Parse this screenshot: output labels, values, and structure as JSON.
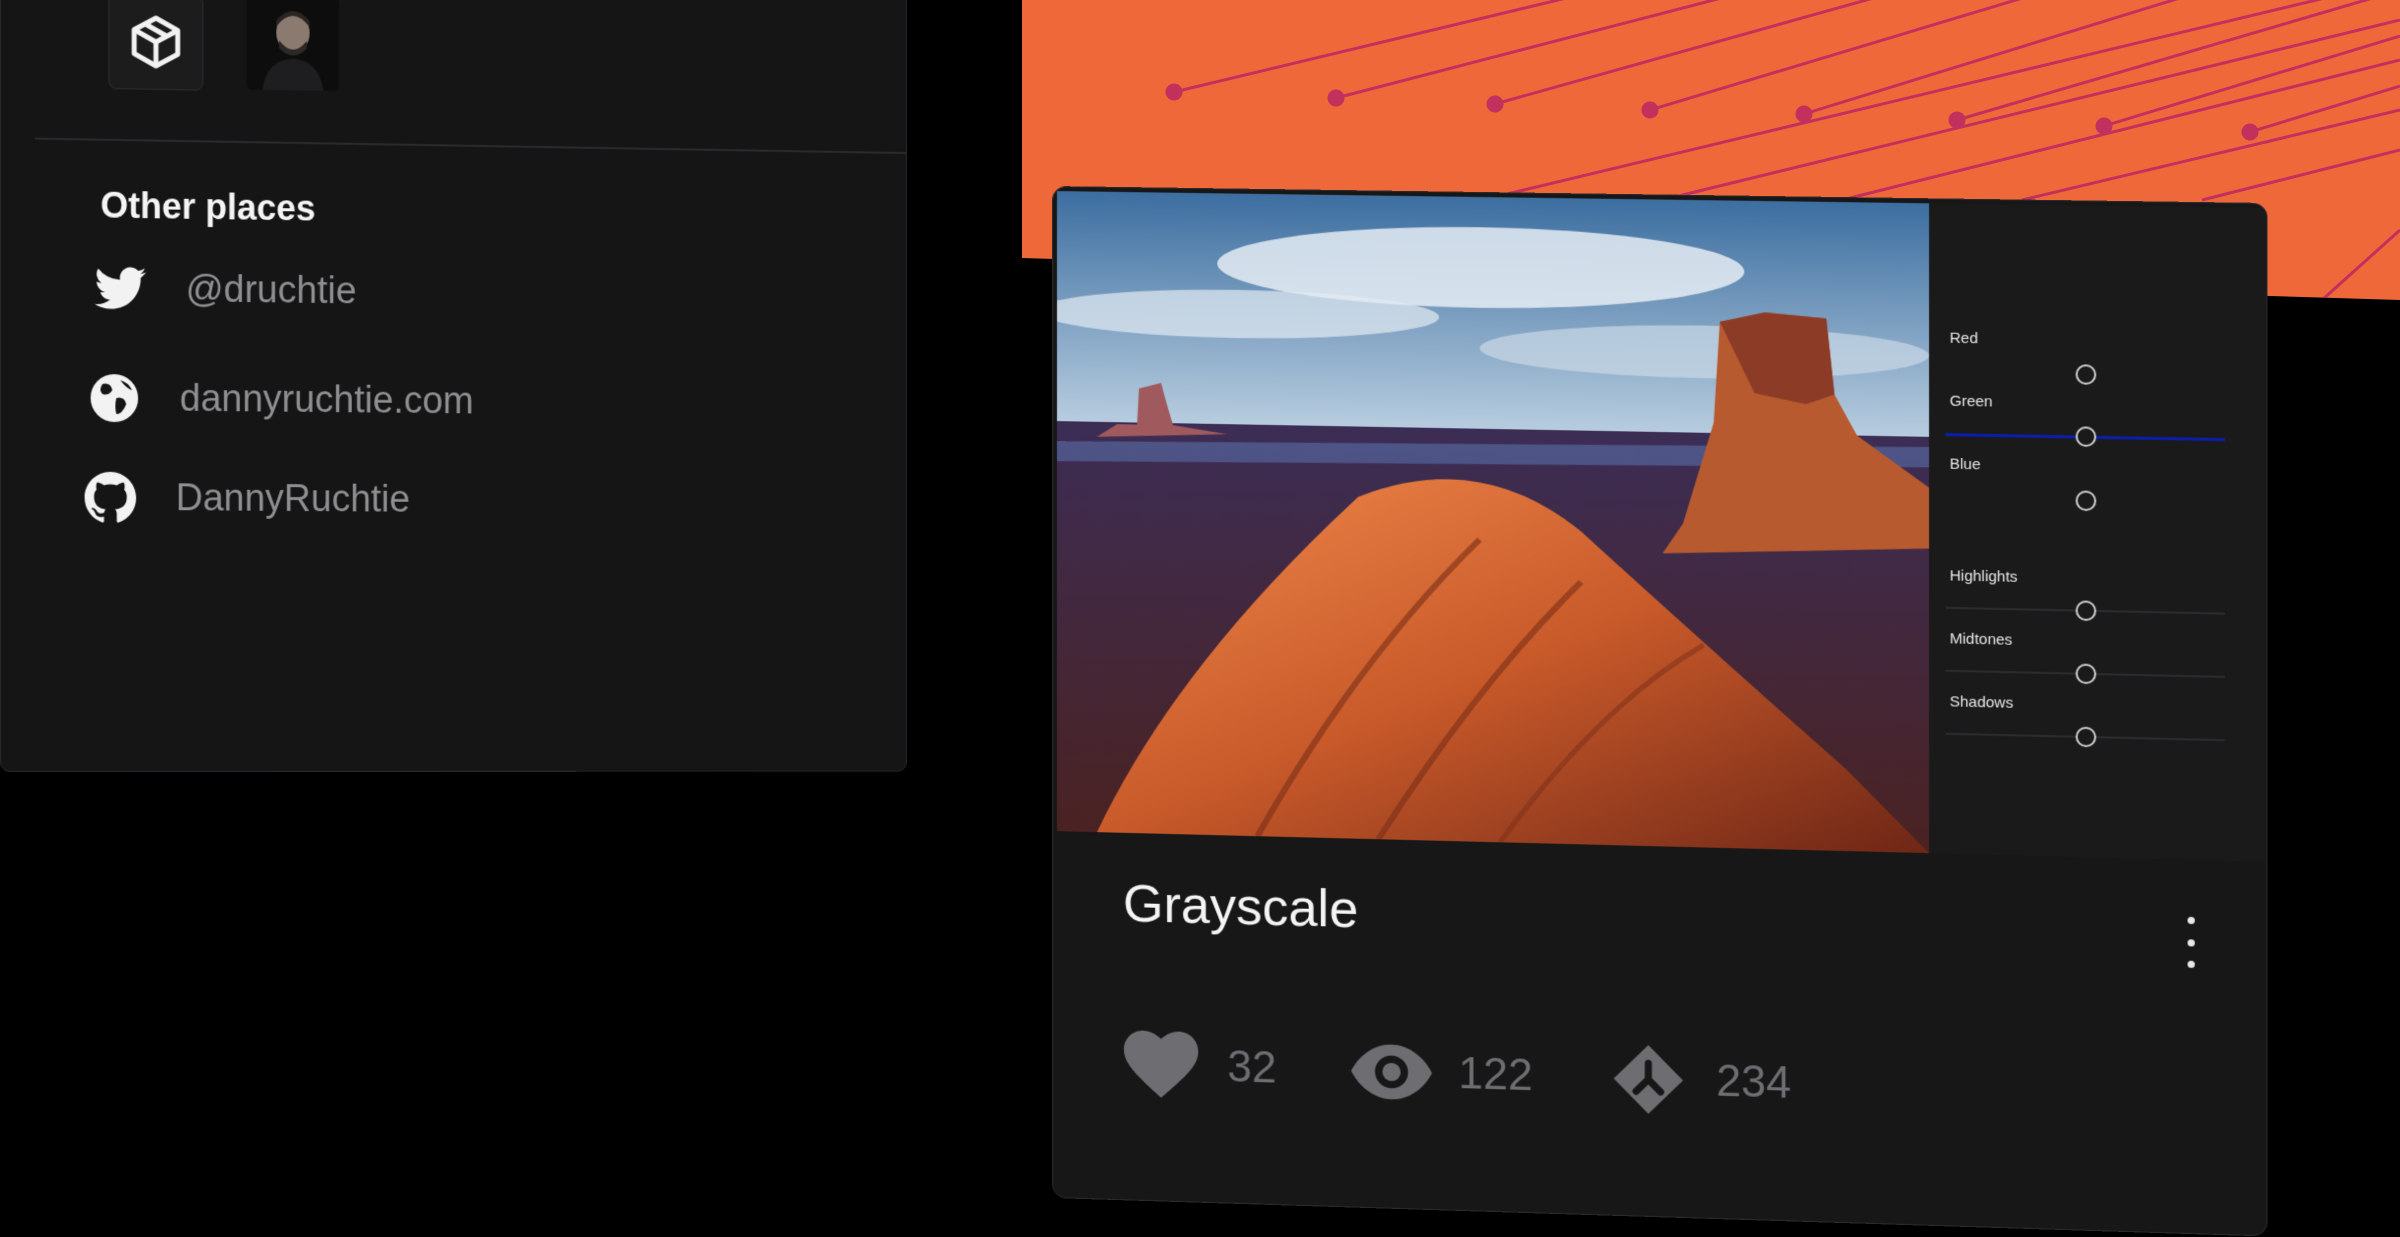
{
  "profile": {
    "top_icons": [
      "codepen-icon",
      "avatar"
    ],
    "section_title": "Other places",
    "links": [
      {
        "icon": "twitter-icon",
        "label": "@druchtie"
      },
      {
        "icon": "globe-icon",
        "label": "dannyruchtie.com"
      },
      {
        "icon": "github-icon",
        "label": "DannyRuchtie"
      }
    ]
  },
  "card": {
    "title": "Grayscale",
    "controls": {
      "red": "Red",
      "green": "Green",
      "blue": "Blue",
      "highlights": "Highlights",
      "midtones": "Midtones",
      "shadows": "Shadows"
    },
    "stats": {
      "likes": "32",
      "views": "122",
      "comments": "234"
    }
  },
  "colors": {
    "banner": "#ee6839",
    "active_track": "#0a1eaa",
    "panel": "#151516"
  }
}
